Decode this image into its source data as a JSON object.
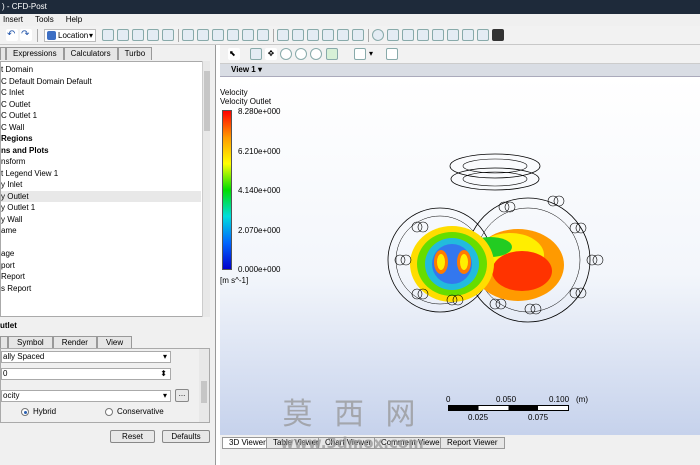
{
  "window": {
    "title": ") - CFD-Post"
  },
  "menu": [
    "Insert",
    "Tools",
    "Help"
  ],
  "toolbar": {
    "location_label": "Location"
  },
  "left_tabs": [
    "",
    "Expressions",
    "Calculators",
    "Turbo"
  ],
  "tree": [
    {
      "label": "t Domain",
      "bold": false
    },
    {
      "label": "C  Default Domain Default",
      "bold": false
    },
    {
      "label": "C  Inlet",
      "bold": false
    },
    {
      "label": "C  Outlet",
      "bold": false
    },
    {
      "label": "C  Outlet 1",
      "bold": false
    },
    {
      "label": "C  Wall",
      "bold": false
    },
    {
      "label": " Regions",
      "bold": true
    },
    {
      "label": "ns and Plots",
      "bold": true
    },
    {
      "label": "nsform",
      "bold": false
    },
    {
      "label": "t Legend View 1",
      "bold": false
    },
    {
      "label": "y Inlet",
      "bold": false
    },
    {
      "label": "y Outlet",
      "bold": false,
      "selected": true
    },
    {
      "label": "y Outlet 1",
      "bold": false
    },
    {
      "label": "y Wall",
      "bold": false
    },
    {
      "label": "ame",
      "bold": false
    },
    {
      "label": "",
      "bold": false
    },
    {
      "label": "age",
      "bold": false
    },
    {
      "label": "port",
      "bold": false
    },
    {
      "label": "Report",
      "bold": false
    },
    {
      "label": "s Report",
      "bold": false
    }
  ],
  "details": {
    "title": "utlet",
    "tabs": [
      "",
      "Symbol",
      "Render",
      "View"
    ],
    "sampling_value": "ally Spaced",
    "number_value": "0",
    "variable_value": "ocity",
    "ellipsis": "...",
    "range_options": [
      "Hybrid",
      "Conservative"
    ],
    "range_selected": "Hybrid",
    "reset_label": "Reset",
    "defaults_label": "Defaults"
  },
  "viewer": {
    "view_label": "View 1",
    "legend": {
      "title": "Velocity",
      "subtitle": "Velocity Outlet",
      "values": [
        "8.280e+000",
        "6.210e+000",
        "4.140e+000",
        "2.070e+000",
        "0.000e+000"
      ],
      "unit": "[m s^-1]"
    },
    "scale": {
      "top": [
        "0",
        "0.050",
        "0.100",
        "(m)"
      ],
      "bottom": [
        "0.025",
        "0.075"
      ]
    },
    "bottom_tabs": [
      "3D Viewer",
      "Table Viewer",
      "Chart Viewer",
      "Comment Viewer",
      "Report Viewer"
    ],
    "active_tab": "3D Viewer"
  },
  "watermark": {
    "cn": "莫 西 网",
    "url": "www.3dmox.com"
  }
}
